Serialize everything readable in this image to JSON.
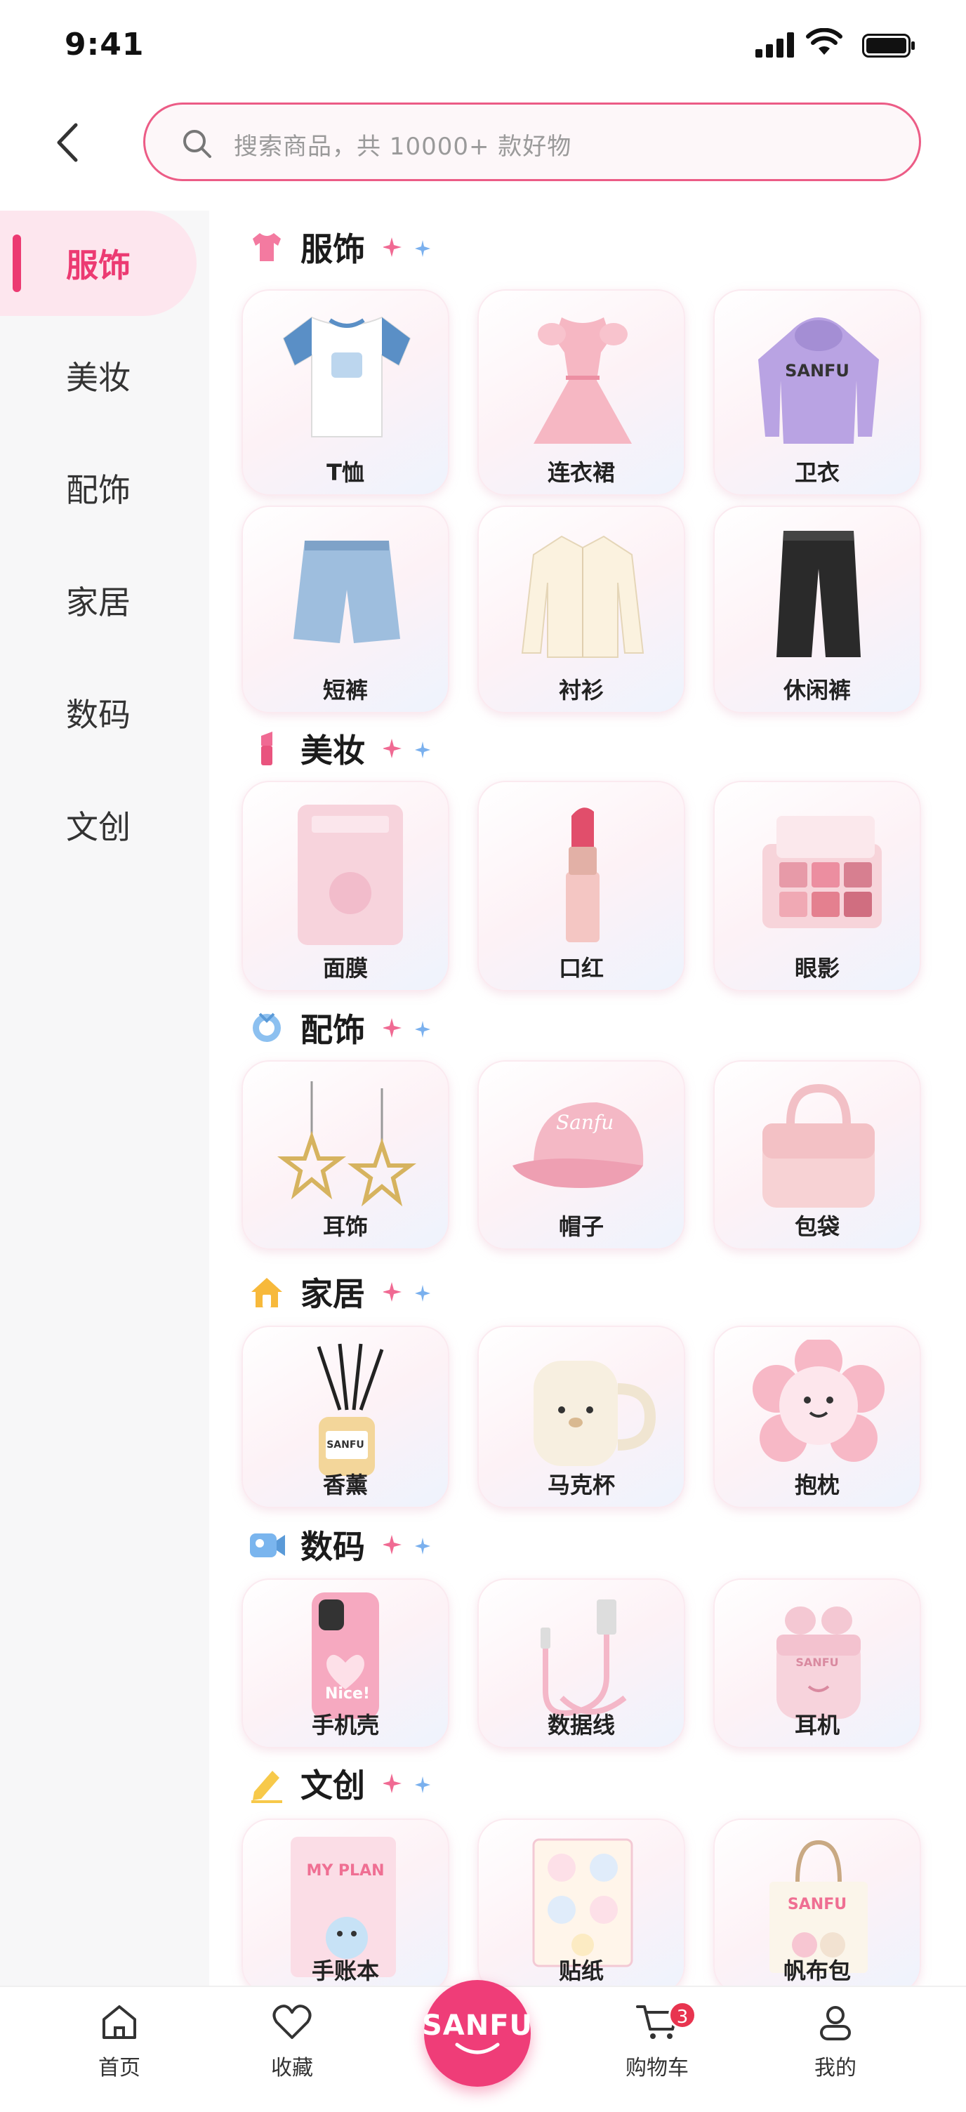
{
  "status": {
    "time": "9:41"
  },
  "search": {
    "placeholder": "搜索商品，共 10000+ 款好物"
  },
  "sidebar": {
    "items": [
      {
        "label": "服饰",
        "active": true
      },
      {
        "label": "美妆"
      },
      {
        "label": "配饰"
      },
      {
        "label": "家居"
      },
      {
        "label": "数码"
      },
      {
        "label": "文创"
      }
    ]
  },
  "sections": [
    {
      "title": "服饰",
      "items": [
        "T恤",
        "连衣裙",
        "卫衣",
        "短裤",
        "衬衫",
        "休闲裤"
      ]
    },
    {
      "title": "美妆",
      "items": [
        "面膜",
        "口红",
        "眼影"
      ]
    },
    {
      "title": "配饰",
      "items": [
        "耳饰",
        "帽子",
        "包袋"
      ]
    },
    {
      "title": "家居",
      "items": [
        "香薰",
        "马克杯",
        "抱枕"
      ]
    },
    {
      "title": "数码",
      "items": [
        "手机壳",
        "数据线",
        "耳机"
      ]
    },
    {
      "title": "文创",
      "items": [
        "手账本",
        "贴纸",
        "帆布包"
      ]
    }
  ],
  "product_text": {
    "hoodie": "SANFU",
    "cap": "Sanfu",
    "diffuser": "SANFU",
    "phonecase": "Nice!",
    "earbuds": "SANFU",
    "notebook": "MY PLAN",
    "tote": "SANFU"
  },
  "tabbar": {
    "home": "首页",
    "favorites": "收藏",
    "logo": "SANFU",
    "cart": "购物车",
    "cart_badge": "3",
    "mine": "我的"
  },
  "colors": {
    "accent": "#ec3a72",
    "sidebar_bg": "#f7f7f8",
    "active_bg": "#fde6ee",
    "badge": "#e8344f"
  }
}
